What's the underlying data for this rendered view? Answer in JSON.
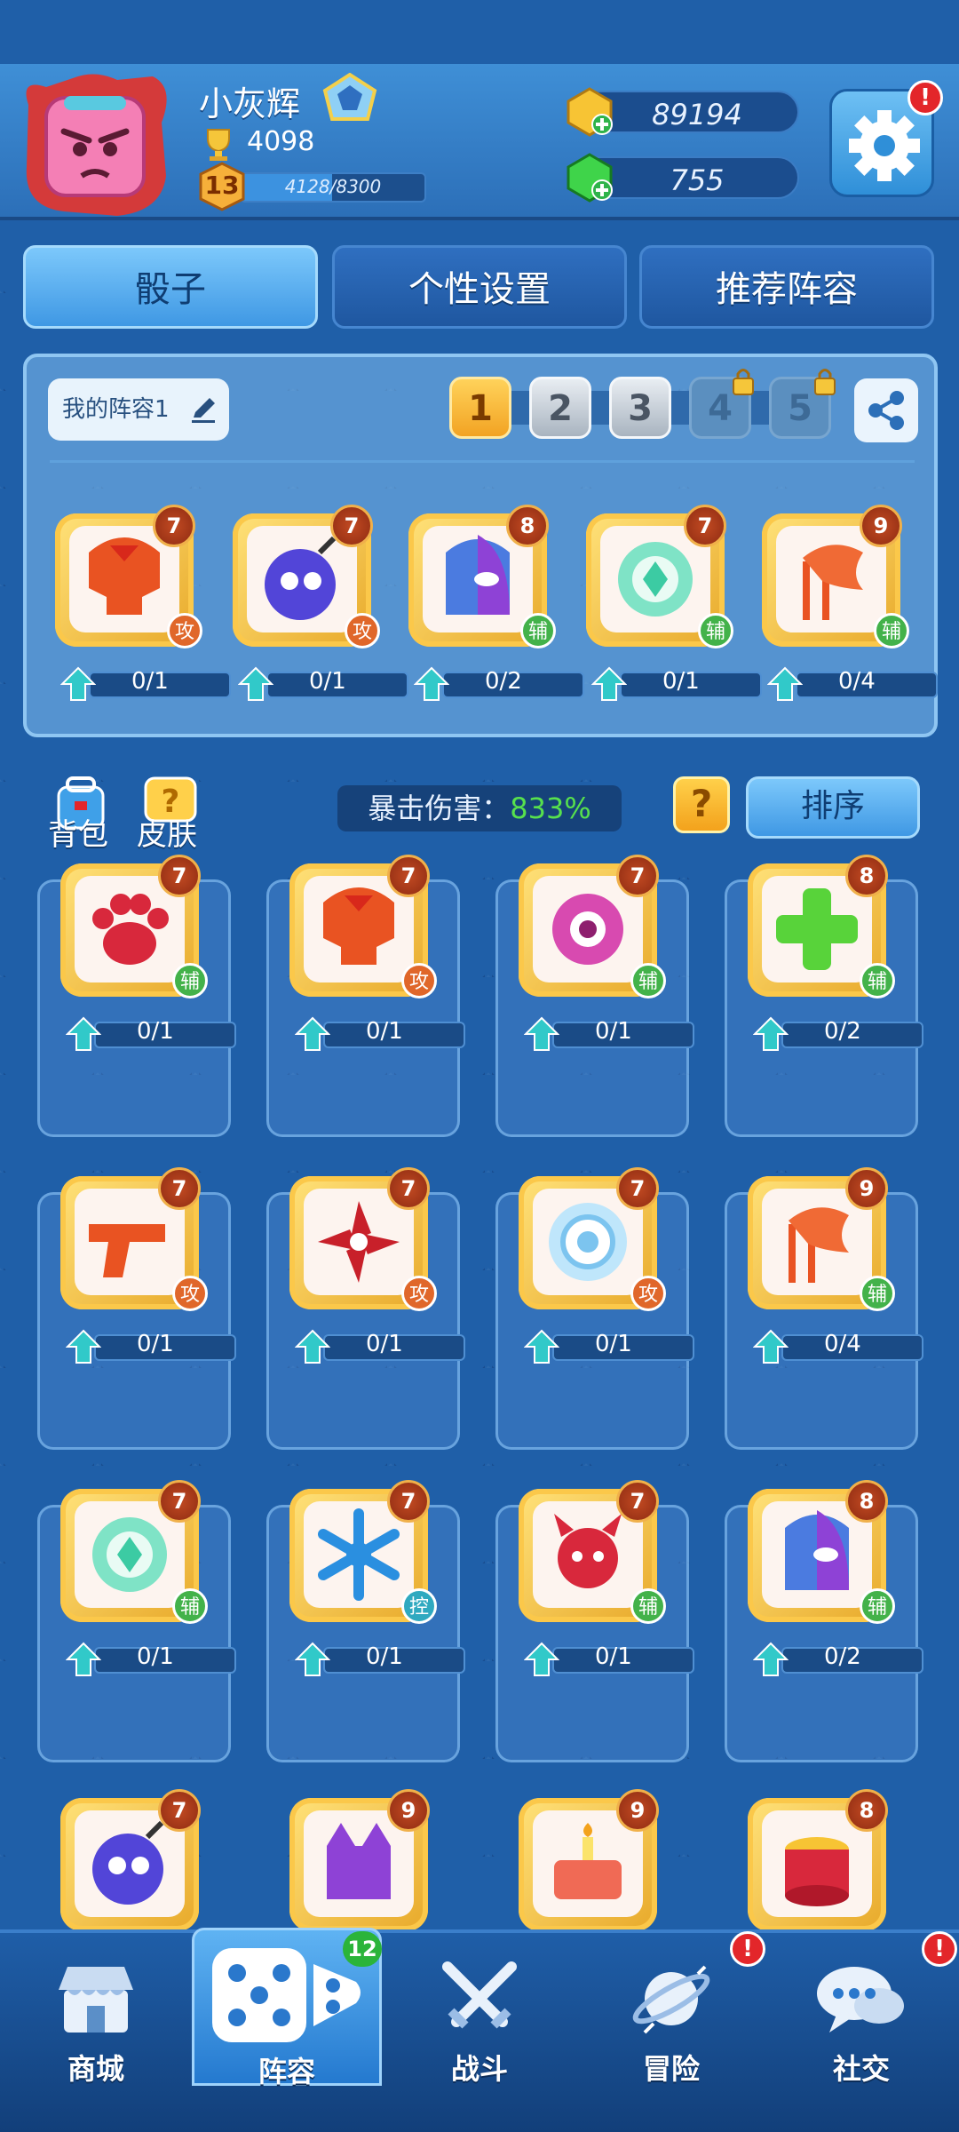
{
  "profile": {
    "name": "小灰辉",
    "trophies": "4098",
    "level": "13",
    "xp": "4128/8300",
    "xp_fraction": 0.497
  },
  "currencies": {
    "gold": "89194",
    "gems": "755"
  },
  "tabs": [
    "骰子",
    "个性设置",
    "推荐阵容"
  ],
  "deck": {
    "name": "我的阵容1",
    "slots": [
      "1",
      "2",
      "3",
      "4",
      "5"
    ],
    "cards": [
      {
        "level": "7",
        "role": "攻",
        "progress": "0/1",
        "icon": "helmet-icon"
      },
      {
        "level": "7",
        "role": "攻",
        "progress": "0/1",
        "icon": "bomb-icon"
      },
      {
        "level": "8",
        "role": "辅",
        "progress": "0/2",
        "icon": "mask-icon"
      },
      {
        "level": "7",
        "role": "辅",
        "progress": "0/1",
        "icon": "swirl-icon"
      },
      {
        "level": "9",
        "role": "辅",
        "progress": "0/4",
        "icon": "flag-icon"
      }
    ]
  },
  "collection": {
    "bag_label": "背包",
    "skin_label": "皮肤",
    "crit_label": "暴击伤害：",
    "crit_value": "833%",
    "help_label": "?",
    "sort_label": "排序",
    "cards": [
      {
        "level": "7",
        "role": "辅",
        "progress": "0/1",
        "icon": "paw-icon"
      },
      {
        "level": "7",
        "role": "攻",
        "progress": "0/1",
        "icon": "helmet-icon"
      },
      {
        "level": "7",
        "role": "辅",
        "progress": "0/1",
        "icon": "eye-icon"
      },
      {
        "level": "8",
        "role": "辅",
        "progress": "0/2",
        "icon": "cross-icon"
      },
      {
        "level": "7",
        "role": "攻",
        "progress": "0/1",
        "icon": "gun-icon"
      },
      {
        "level": "7",
        "role": "攻",
        "progress": "0/1",
        "icon": "shuriken-icon"
      },
      {
        "level": "7",
        "role": "攻",
        "progress": "0/1",
        "icon": "sun-icon"
      },
      {
        "level": "9",
        "role": "辅",
        "progress": "0/4",
        "icon": "flag-icon"
      },
      {
        "level": "7",
        "role": "辅",
        "progress": "0/1",
        "icon": "swirl-icon"
      },
      {
        "level": "7",
        "role": "控",
        "progress": "0/1",
        "icon": "snowflake-icon"
      },
      {
        "level": "7",
        "role": "辅",
        "progress": "0/1",
        "icon": "devil-icon"
      },
      {
        "level": "8",
        "role": "辅",
        "progress": "0/2",
        "icon": "mask-icon"
      },
      {
        "level": "7",
        "role": "",
        "progress": "",
        "icon": "bomb-icon"
      },
      {
        "level": "9",
        "role": "",
        "progress": "",
        "icon": "cat-icon"
      },
      {
        "level": "9",
        "role": "",
        "progress": "",
        "icon": "cake-icon"
      },
      {
        "level": "8",
        "role": "",
        "progress": "",
        "icon": "drum-icon"
      }
    ]
  },
  "nav": {
    "items": [
      "商城",
      "阵容",
      "战斗",
      "冒险",
      "社交"
    ],
    "lineup_badge": "12",
    "alert": "!"
  },
  "colors": {
    "attack": "#e0672a",
    "support": "#43b24a",
    "control": "#2fa9c0",
    "accent": "#3f98e4"
  }
}
